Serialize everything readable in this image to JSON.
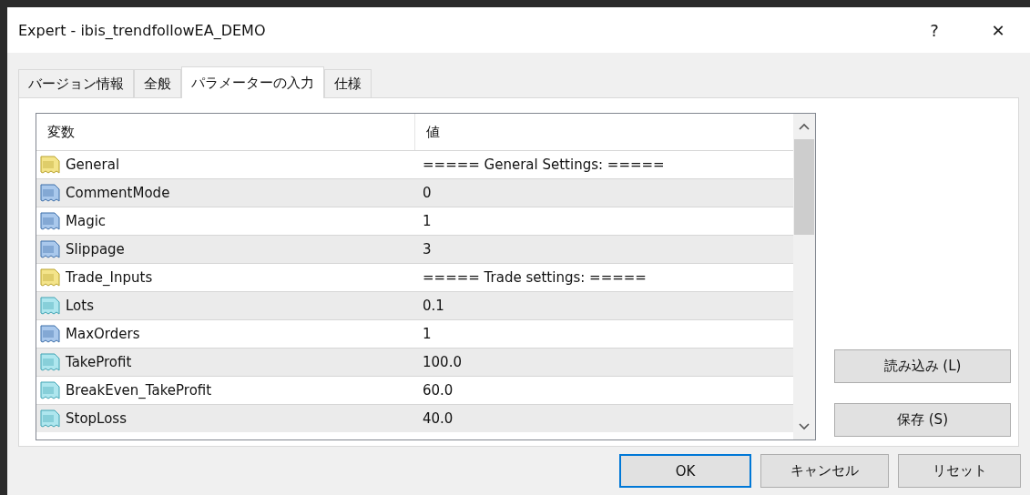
{
  "window": {
    "title": "Expert - ibis_trendfollowEA_DEMO",
    "help": "?",
    "close": "✕"
  },
  "tabs": [
    {
      "label": "バージョン情報",
      "selected": false
    },
    {
      "label": "全般",
      "selected": false
    },
    {
      "label": "パラメーターの入力",
      "selected": true
    },
    {
      "label": "仕様",
      "selected": false
    }
  ],
  "table": {
    "columns": [
      "変数",
      "値"
    ],
    "rows": [
      {
        "kind": "string",
        "name": "General",
        "value": "===== General Settings: ====="
      },
      {
        "kind": "integer",
        "name": "CommentMode",
        "value": "0"
      },
      {
        "kind": "integer",
        "name": "Magic",
        "value": "1"
      },
      {
        "kind": "integer",
        "name": "Slippage",
        "value": "3"
      },
      {
        "kind": "string",
        "name": "Trade_Inputs",
        "value": "===== Trade settings: ====="
      },
      {
        "kind": "double",
        "name": "Lots",
        "value": "0.1"
      },
      {
        "kind": "integer",
        "name": "MaxOrders",
        "value": "1"
      },
      {
        "kind": "double",
        "name": "TakeProfit",
        "value": "100.0"
      },
      {
        "kind": "double",
        "name": "BreakEven_TakeProfit",
        "value": "60.0"
      },
      {
        "kind": "double",
        "name": "StopLoss",
        "value": "40.0"
      }
    ]
  },
  "side_buttons": [
    "読み込み (L)",
    "保存 (S)"
  ],
  "buttons": [
    {
      "label": "OK",
      "default": true
    },
    {
      "label": "キャンセル",
      "default": false
    },
    {
      "label": "リセット",
      "default": false
    }
  ]
}
